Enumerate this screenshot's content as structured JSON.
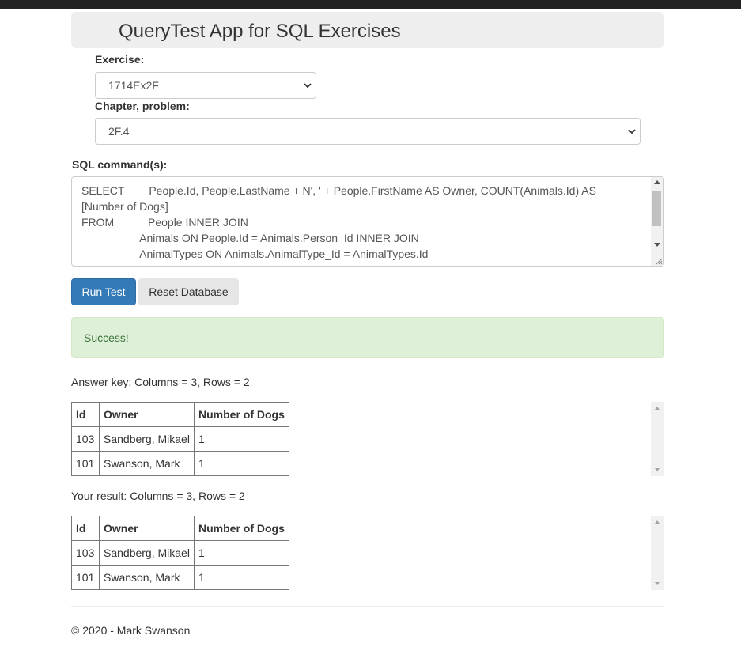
{
  "header": {
    "title": "QueryTest App for SQL Exercises"
  },
  "exercise": {
    "label": "Exercise:",
    "selected": "1714Ex2F"
  },
  "chapter": {
    "label": "Chapter, problem:",
    "selected": "2F.4"
  },
  "sql": {
    "label": "SQL command(s):",
    "value": "SELECT        People.Id, People.LastName + N', ' + People.FirstName AS Owner, COUNT(Animals.Id) AS\n[Number of Dogs]\nFROM           People INNER JOIN\n                   Animals ON People.Id = Animals.Person_Id INNER JOIN\n                   AnimalTypes ON Animals.AnimalType_Id = AnimalTypes.Id\nGROUP BY People.Id, People.LastName + N', ' + People.FirstName, AnimalTypes.Type"
  },
  "buttons": {
    "run": "Run Test",
    "reset": "Reset Database"
  },
  "alert": {
    "text": "Success!"
  },
  "answer_key": {
    "summary": "Answer key: Columns = 3, Rows = 2",
    "columns": [
      "Id",
      "Owner",
      "Number of Dogs"
    ],
    "rows": [
      [
        "103",
        "Sandberg, Mikael",
        "1"
      ],
      [
        "101",
        "Swanson, Mark",
        "1"
      ]
    ]
  },
  "your_result": {
    "summary": "Your result: Columns = 3, Rows = 2",
    "columns": [
      "Id",
      "Owner",
      "Number of Dogs"
    ],
    "rows": [
      [
        "103",
        "Sandberg, Mikael",
        "1"
      ],
      [
        "101",
        "Swanson, Mark",
        "1"
      ]
    ]
  },
  "footer": {
    "text": "© 2020 - Mark Swanson"
  }
}
